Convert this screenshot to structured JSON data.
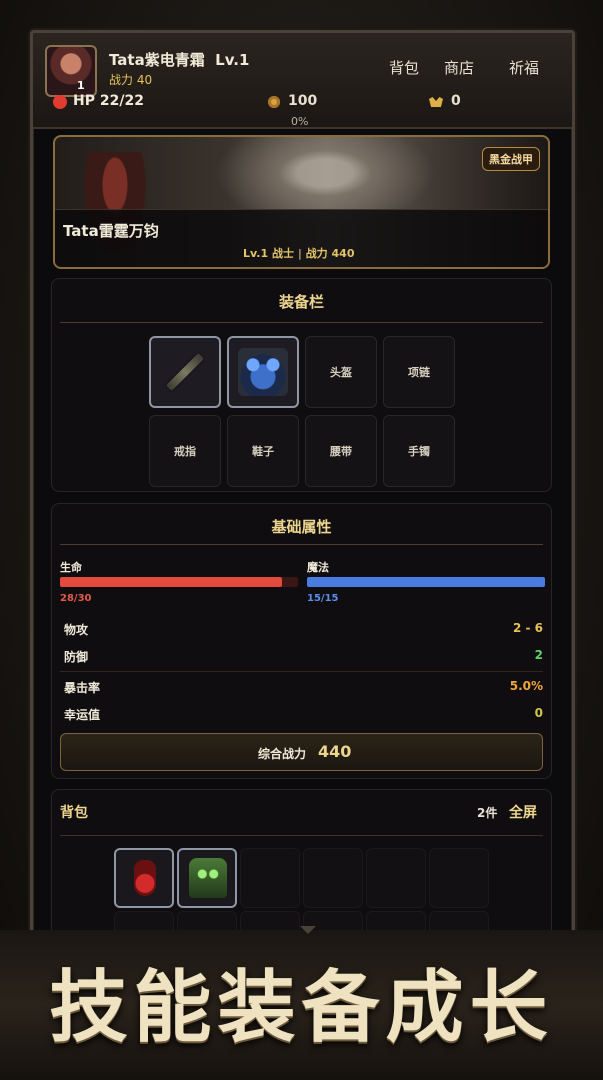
{
  "header": {
    "player_name": "Tata紫电青霜",
    "level": "Lv.1",
    "avatar_level": "1",
    "power_label": "战力",
    "power_value": "40",
    "nav": [
      "背包",
      "商店",
      "祈福"
    ],
    "hp_label": "HP",
    "hp_value": "22/22",
    "coins": "100",
    "ingots": "0",
    "exp_percent": "0%"
  },
  "hero": {
    "name": "Tata雷霆万钧",
    "badge": "黑金战甲",
    "level": "Lv.1",
    "class": "战士",
    "power_text": "战力 440"
  },
  "equipment": {
    "title": "装备栏",
    "slots": [
      "",
      "",
      "头盔",
      "项链",
      "戒指",
      "鞋子",
      "腰带",
      "手镯"
    ]
  },
  "attributes": {
    "title": "基础属性",
    "hp_label": "生命",
    "hp_value": "28/30",
    "hp_fraction": 0.9333,
    "mp_label": "魔法",
    "mp_value": "15/15",
    "mp_fraction": 1.0,
    "stats": [
      {
        "label": "物攻",
        "value": "2 - 6",
        "color": "#e6c24e"
      },
      {
        "label": "防御",
        "value": "2",
        "color": "#5fd06a"
      },
      {
        "label": "暴击率",
        "value": "5.0%",
        "color": "#f0a63a"
      },
      {
        "label": "幸运值",
        "value": "0",
        "color": "#cfc74a"
      }
    ],
    "total_label": "综合战力",
    "total_value": "440"
  },
  "inventory": {
    "title": "背包",
    "count": "2件",
    "fullscreen": "全屏"
  },
  "slogan": "技能装备成长",
  "colors": {
    "gold": "#ecd58e",
    "hp_bar": "#e24a3b",
    "mp_bar": "#4a7be0",
    "frame": "#4a4238"
  }
}
